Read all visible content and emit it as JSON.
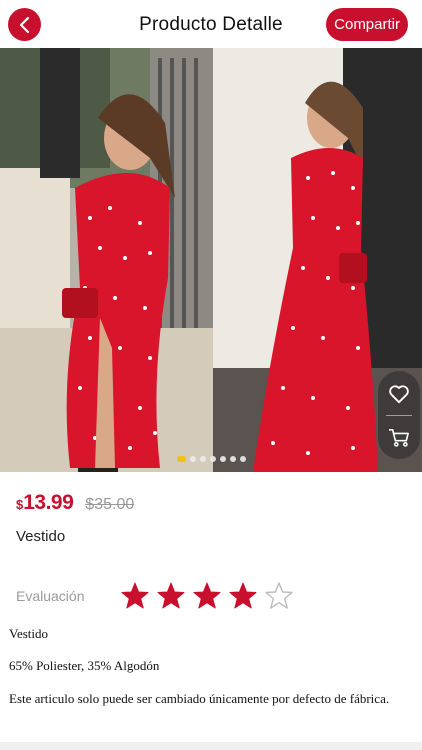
{
  "header": {
    "title": "Producto Detalle",
    "share_label": "Compartir",
    "back_icon": "chevron-left-icon"
  },
  "gallery": {
    "slide_count": 7,
    "active_slide": 1,
    "icons": [
      "heart-icon",
      "cart-icon"
    ]
  },
  "product": {
    "currency_symbol": "$",
    "price": "13.99",
    "old_price": "$35.00",
    "name": "Vestido"
  },
  "rating": {
    "label": "Evaluación",
    "value": 4,
    "max": 5
  },
  "description": {
    "line1": "Vestido",
    "line2": "65% Poliester, 35% Algodón",
    "line3": "Este articulo solo puede ser cambiado únicamente por defecto de fábrica."
  },
  "colors": {
    "accent": "#c8102e",
    "star": "#c8102e",
    "dot_active": "#f2c200"
  }
}
